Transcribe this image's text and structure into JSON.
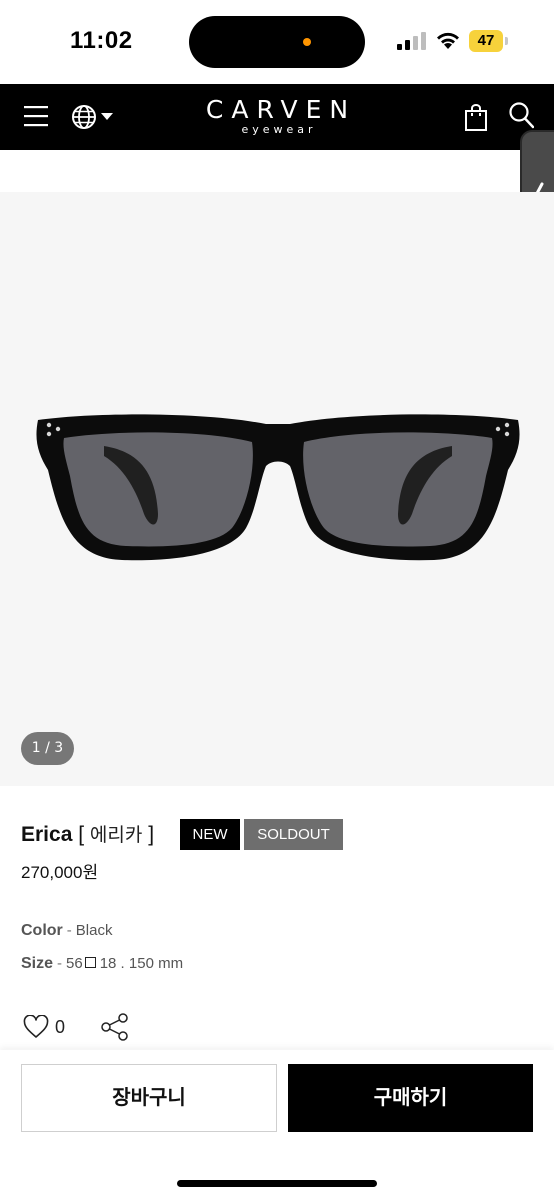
{
  "status_bar": {
    "time": "11:02",
    "battery": "47"
  },
  "header": {
    "logo_main": "CARVEN",
    "logo_sub": "eyewear"
  },
  "gallery": {
    "page_indicator": "1 / 3"
  },
  "product": {
    "name": "Erica",
    "bracket_open": "[",
    "korean_name": "에리카",
    "bracket_close": "]",
    "badges": {
      "new": "NEW",
      "soldout": "SOLDOUT"
    },
    "price": "270,000원",
    "color_label": "Color",
    "color_value": "Black",
    "size_label": "Size",
    "size_lens": "56",
    "size_rest": "18 . 150 mm",
    "spec_separator": "-"
  },
  "actions": {
    "like_count": "0",
    "cart_label": "장바구니",
    "buy_label": "구매하기"
  },
  "colors": {
    "nav_background": "#000000",
    "soldout_badge": "#6e6e6e",
    "battery": "#f7d23b"
  },
  "icons": [
    "menu-icon",
    "globe-icon",
    "shopping-bag-icon",
    "search-icon",
    "chevron-left-icon",
    "heart-icon",
    "share-icon",
    "signal-icon",
    "wifi-icon"
  ]
}
